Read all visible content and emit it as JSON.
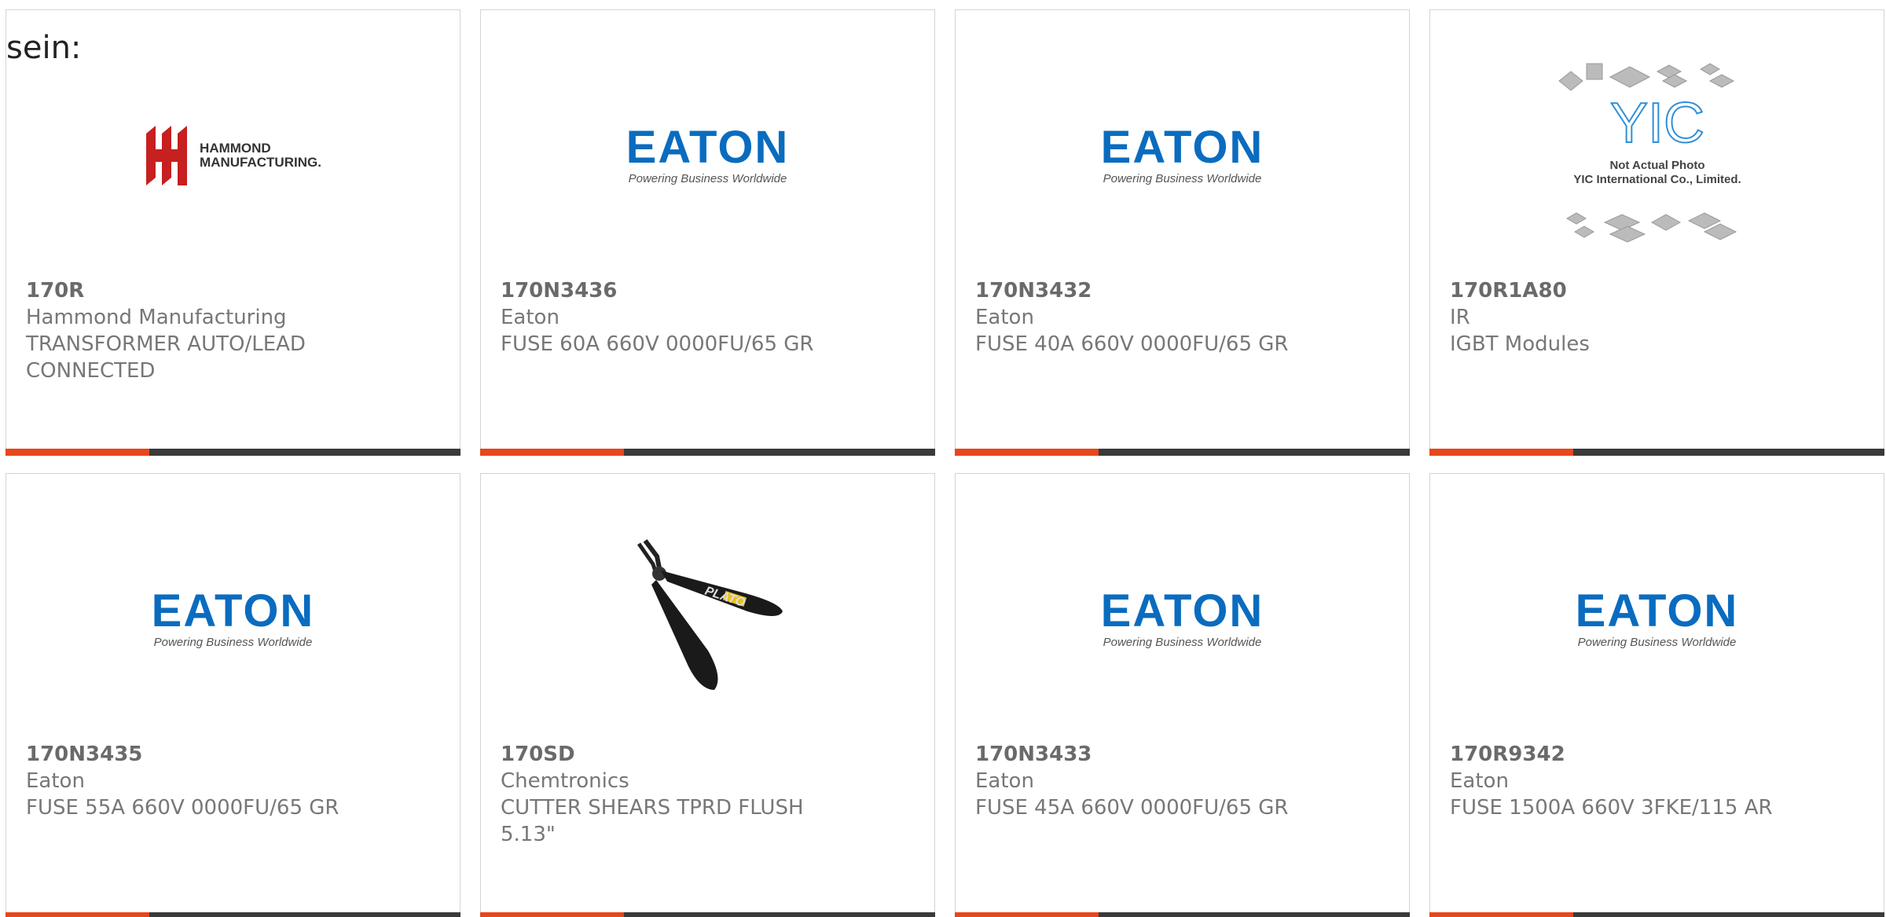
{
  "intro_text": "sein:",
  "logos": {
    "eaton_word": "EATON",
    "eaton_tagline": "Powering Business Worldwide",
    "hammond_line1": "HAMMOND",
    "hammond_line2": "MANUFACTURING.",
    "yic_mark": "YIC",
    "yic_line1": "Not Actual Photo",
    "yic_line2": "YIC International Co., Limited.",
    "plato_label": "PLATO"
  },
  "colors": {
    "accent": "#e8461b",
    "bar": "#3a3a3a",
    "eaton_blue": "#0a6cbf",
    "hammond_red": "#c62020"
  },
  "products": [
    {
      "part": "170R",
      "maker": "Hammond Manufacturing",
      "desc": "TRANSFORMER AUTO/LEAD CONNECTED",
      "image": "hammond-logo"
    },
    {
      "part": "170N3436",
      "maker": "Eaton",
      "desc": "FUSE 60A 660V 0000FU/65 GR",
      "image": "eaton-logo"
    },
    {
      "part": "170N3432",
      "maker": "Eaton",
      "desc": "FUSE 40A 660V 0000FU/65 GR",
      "image": "eaton-logo"
    },
    {
      "part": "170R1A80",
      "maker": "IR",
      "desc": "IGBT Modules",
      "image": "yic-placeholder"
    },
    {
      "part": "170N3435",
      "maker": "Eaton",
      "desc": "FUSE 55A 660V 0000FU/65 GR",
      "image": "eaton-logo"
    },
    {
      "part": "170SD",
      "maker": "Chemtronics",
      "desc": "CUTTER SHEARS TPRD FLUSH 5.13\"",
      "image": "cutter-photo"
    },
    {
      "part": "170N3433",
      "maker": "Eaton",
      "desc": "FUSE 45A 660V 0000FU/65 GR",
      "image": "eaton-logo"
    },
    {
      "part": "170R9342",
      "maker": "Eaton",
      "desc": "FUSE 1500A 660V 3FKE/115 AR",
      "image": "eaton-logo"
    }
  ]
}
